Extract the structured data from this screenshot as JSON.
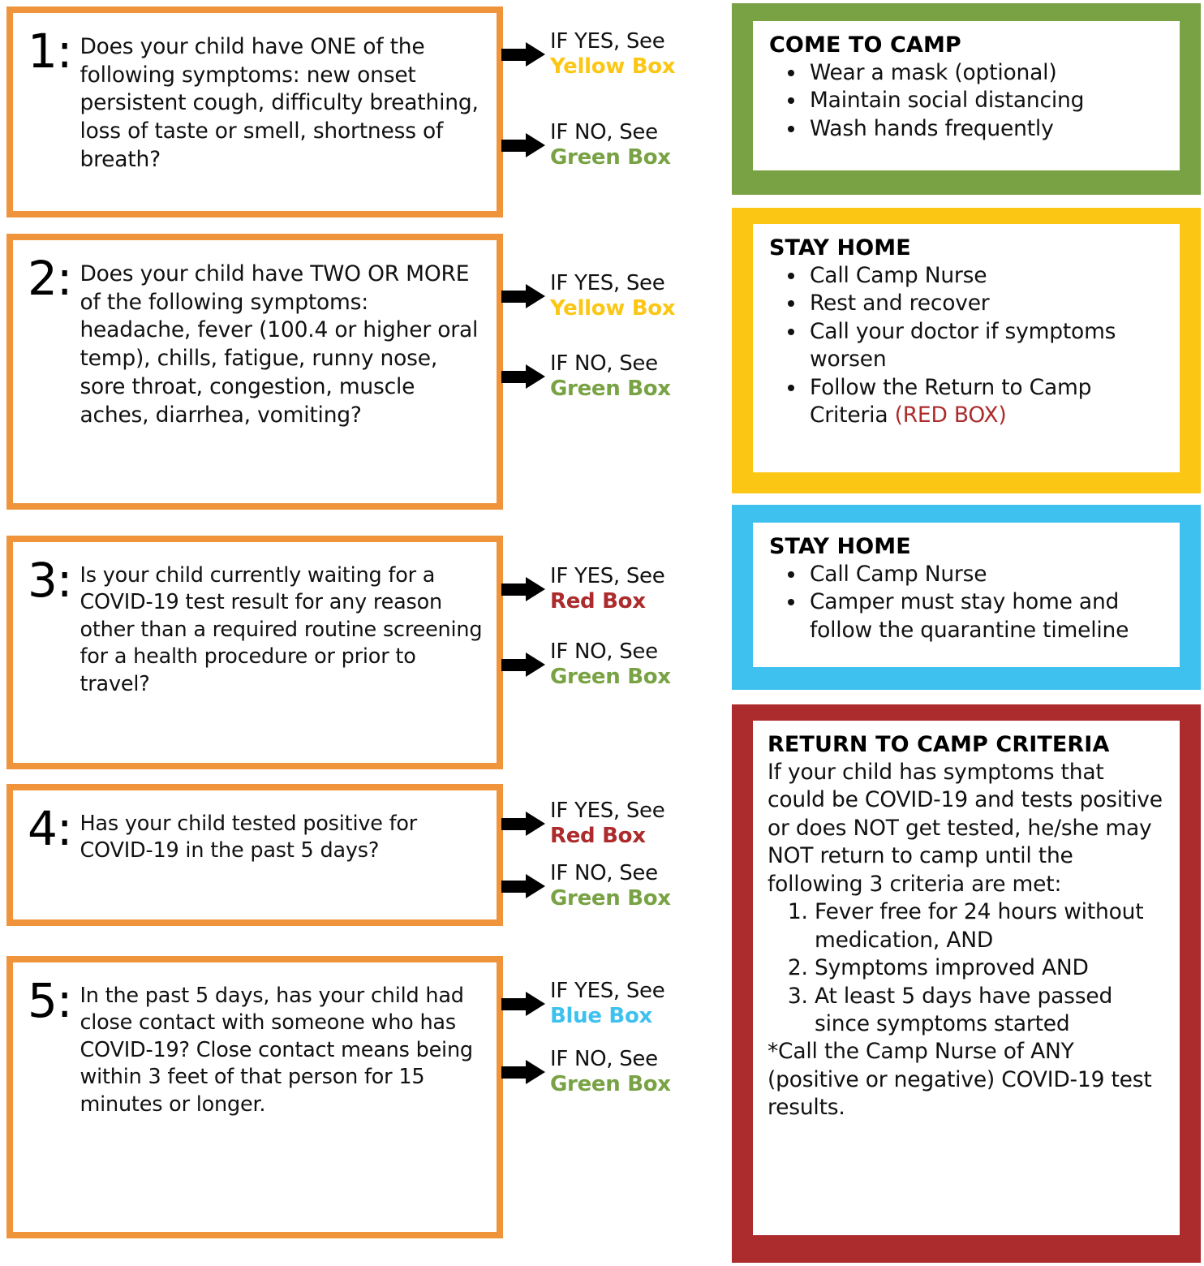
{
  "colors": {
    "orange": "#F0943C",
    "green": "#78A244",
    "yellow": "#FCC714",
    "blue": "#3EC1EF",
    "red": "#AC2B2C",
    "text": "#111111"
  },
  "questions": [
    {
      "number": "1:",
      "text": "Does your child have ONE of the following symptoms: new onset persistent cough, difficulty breathing, loss of taste or smell, shortness of breath?",
      "answers": [
        {
          "condition": "IF YES, See",
          "target": "Yellow Box",
          "target_color": "#FCC714"
        },
        {
          "condition": "IF NO, See",
          "target": "Green Box",
          "target_color": "#78A244"
        }
      ]
    },
    {
      "number": "2:",
      "text": "Does your child have TWO OR MORE of the following symptoms: headache, fever (100.4 or higher oral temp), chills, fatigue, runny nose, sore throat, congestion, muscle aches, diarrhea, vomiting?",
      "answers": [
        {
          "condition": "IF YES, See",
          "target": "Yellow Box",
          "target_color": "#FCC714"
        },
        {
          "condition": "IF NO, See",
          "target": "Green Box",
          "target_color": "#78A244"
        }
      ]
    },
    {
      "number": "3:",
      "text": "Is your child currently waiting for a COVID-19 test result for any reason other than a required routine screening for a health procedure or prior to travel?",
      "answers": [
        {
          "condition": "IF YES, See",
          "target": "Red Box",
          "target_color": "#AC2B2C"
        },
        {
          "condition": "IF NO, See",
          "target": "Green Box",
          "target_color": "#78A244"
        }
      ]
    },
    {
      "number": "4:",
      "text": "Has your child tested positive for COVID-19 in the past 5 days?",
      "answers": [
        {
          "condition": "IF YES, See",
          "target": "Red Box",
          "target_color": "#AC2B2C"
        },
        {
          "condition": "IF NO, See",
          "target": "Green Box",
          "target_color": "#78A244"
        }
      ]
    },
    {
      "number": "5:",
      "text": "In the past 5 days, has your child had close contact with someone who has COVID-19? Close contact means being within 3 feet of that person for 15 minutes or longer.",
      "answers": [
        {
          "condition": "IF YES, See",
          "target": "Blue Box",
          "target_color": "#3EC1EF"
        },
        {
          "condition": "IF NO, See",
          "target": "Green Box",
          "target_color": "#78A244"
        }
      ]
    }
  ],
  "outcomes": {
    "green": {
      "title": "COME TO CAMP",
      "bullets": [
        "Wear a mask (optional)",
        "Maintain social distancing",
        "Wash hands frequently"
      ]
    },
    "yellow": {
      "title": "STAY HOME",
      "bullets": [
        "Call Camp Nurse",
        "Rest and recover",
        "Call your doctor if symptoms worsen"
      ],
      "last_bullet_main": "Follow the Return to Camp Criteria ",
      "last_bullet_red": "(RED BOX)"
    },
    "blue": {
      "title": "STAY HOME",
      "bullets": [
        "Call Camp Nurse",
        "Camper must stay home and follow the quarantine timeline"
      ]
    },
    "red": {
      "title": "RETURN TO CAMP CRITERIA",
      "intro": "If your child has symptoms that could be COVID-19 and tests positive or does NOT get tested, he/she may NOT return to camp until the following 3 criteria are met:",
      "criteria": [
        "Fever free for 24 hours without medication, AND",
        "Symptoms improved AND",
        "At least 5 days have passed since symptoms started"
      ],
      "footnote": "*Call the Camp Nurse of ANY (positive or negative) COVID-19 test results."
    }
  }
}
